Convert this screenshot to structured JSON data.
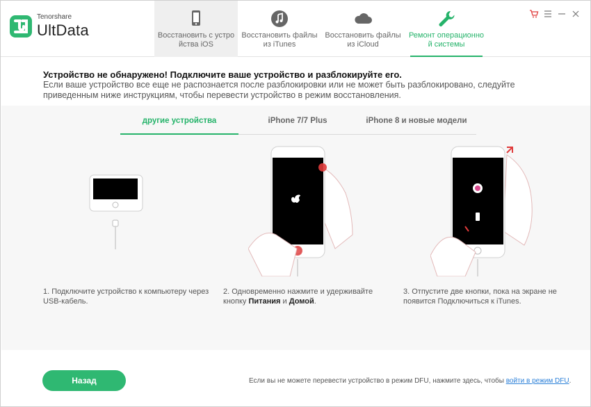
{
  "app": {
    "brand_small": "Tenorshare",
    "brand_big": "UltData",
    "accent": "#25b36a"
  },
  "tabs": [
    {
      "label": "Восстановить с устро йства iOS",
      "icon": "phone-icon"
    },
    {
      "label": "Восстановить файлы из iTunes",
      "icon": "music-icon"
    },
    {
      "label": "Восстановить файлы из iCloud",
      "icon": "cloud-icon"
    },
    {
      "label": "Ремонт операционно й системы",
      "icon": "wrench-icon"
    }
  ],
  "message": {
    "title": "Устройство не обнаружено! Подключите ваше устройство и разблокируйте его.",
    "body": "Если ваше устройство все еще не распознается после разблокировки или не может быть разблокировано, следуйте приведенным ниже инструкциям, чтобы перевести устройство в режим восстановления."
  },
  "subtabs": [
    {
      "label": "другие устройства"
    },
    {
      "label": "iPhone 7/7 Plus"
    },
    {
      "label": "iPhone 8 и новые модели"
    }
  ],
  "steps": {
    "step1": "1. Подключите устройство к компьютеру через USB-кабель.",
    "step2_a": "2. Одновременно нажмите и удерживайте кнопку ",
    "step2_b1": "Питания",
    "step2_and": " и ",
    "step2_b2": "Домой",
    "step2_end": ".",
    "step3": "3. Отпустите две кнопки, пока на экране не появится Подключиться к iTunes."
  },
  "footer": {
    "back_label": "Назад",
    "note": "Если вы не можете перевести устройство в режим DFU, нажмите здесь, чтобы ",
    "link": "войти в режим DFU",
    "note_end": "."
  }
}
